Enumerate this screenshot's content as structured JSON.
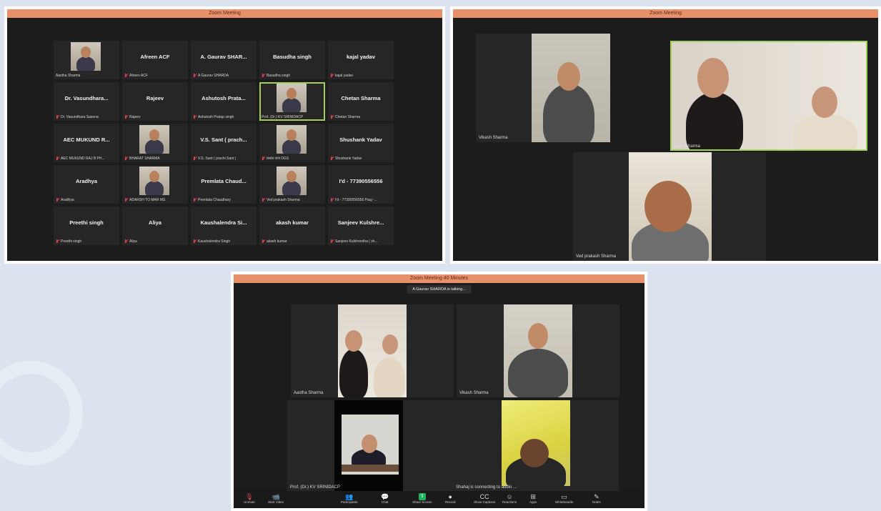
{
  "gallery": {
    "title": "Zoom Meeting",
    "tiles": [
      {
        "name": "",
        "label": "Aastha Sharma",
        "video": true,
        "muted": false
      },
      {
        "name": "Afreen ACF",
        "label": "Afreen ACF",
        "video": false,
        "muted": true
      },
      {
        "name": "A. Gaurav SHAR...",
        "label": "A Gaurav SHARDA",
        "video": false,
        "muted": true
      },
      {
        "name": "Basudha singh",
        "label": "Basudha singh",
        "video": false,
        "muted": true
      },
      {
        "name": "kajal yadav",
        "label": "kajal yadav",
        "video": false,
        "muted": true
      },
      {
        "name": "Dr. Vasundhara...",
        "label": "Dr. Vasundhara Saxena",
        "video": false,
        "muted": true
      },
      {
        "name": "Rajeev",
        "label": "Rajeev",
        "video": false,
        "muted": true
      },
      {
        "name": "Ashutosh Prata...",
        "label": "Ashutosh Pratap singh",
        "video": false,
        "muted": true
      },
      {
        "name": "",
        "label": "Prof. (Dr.) KV SRINIDACP",
        "video": true,
        "muted": false,
        "active": true
      },
      {
        "name": "Chetan Sharma",
        "label": "Chetan Sharma",
        "video": false,
        "muted": true
      },
      {
        "name": "AEC MUKUND R...",
        "label": "AEC MUKUND RAJ B PH...",
        "video": false,
        "muted": true
      },
      {
        "name": "",
        "label": "BHARAT SHARMA",
        "video": true,
        "muted": true
      },
      {
        "name": "V.S. Sant ( prach...",
        "label": "V.S. Sant ( prachi Sant )",
        "video": false,
        "muted": true
      },
      {
        "name": "",
        "label": "प्रशांत राज DGS",
        "video": true,
        "muted": true
      },
      {
        "name": "Shushank Yadav",
        "label": "Shushank Yadav",
        "video": false,
        "muted": true
      },
      {
        "name": "Aradhya",
        "label": "Aradhya",
        "video": false,
        "muted": true
      },
      {
        "name": "",
        "label": "ADARSH TO MAR MS",
        "video": true,
        "muted": true
      },
      {
        "name": "Premlata Chaud...",
        "label": "Premlata Chaudhary",
        "video": false,
        "muted": true
      },
      {
        "name": "",
        "label": "Ved prakash Sharma",
        "video": true,
        "muted": true
      },
      {
        "name": "I'd - 77390556556",
        "label": "I'd - 77390556556 Pauj -...",
        "video": false,
        "muted": true
      },
      {
        "name": "Preethi singh",
        "label": "Preethi singh",
        "video": false,
        "muted": true
      },
      {
        "name": "Aliya",
        "label": "Aliya",
        "video": false,
        "muted": true
      },
      {
        "name": "Kaushalendra Si...",
        "label": "Kaushalendra Singh",
        "video": false,
        "muted": true
      },
      {
        "name": "akash kumar",
        "label": "akash kumar",
        "video": false,
        "muted": true
      },
      {
        "name": "Sanjeev Kulshre...",
        "label": "Sanjeev Kulshrestha ( sh...",
        "video": false,
        "muted": true
      }
    ]
  },
  "speaker": {
    "title": "Zoom Meeting",
    "tiles": [
      {
        "label": "Vikash Sharma"
      },
      {
        "label": "aasthasharma"
      },
      {
        "label": "Ved prakash Sharma"
      }
    ]
  },
  "meeting": {
    "title": "Zoom Meeting 40 Minutes",
    "talking": "A Gaurav SHARDA is talking...",
    "tiles": [
      {
        "label": "Aastha Sharma"
      },
      {
        "label": "Vikash Sharma"
      },
      {
        "label": "Prof. (Dr.) KV SRINIDACP"
      },
      {
        "label": "Shahaj is connecting to audio ..."
      }
    ],
    "toolbar": [
      {
        "label": "Unmute",
        "icon": "mic-off-icon",
        "glyph": "🎙",
        "style": "red"
      },
      {
        "label": "Start Video",
        "icon": "video-off-icon",
        "glyph": "📹",
        "style": "red"
      },
      {
        "label": "Participants",
        "icon": "participants-icon",
        "glyph": "👥",
        "style": ""
      },
      {
        "label": "Chat",
        "icon": "chat-icon",
        "glyph": "💬",
        "style": ""
      },
      {
        "label": "Share Screen",
        "icon": "share-screen-icon",
        "glyph": "⇧",
        "style": "green"
      },
      {
        "label": "Record",
        "icon": "record-icon",
        "glyph": "●",
        "style": ""
      },
      {
        "label": "Show Captions",
        "icon": "captions-icon",
        "glyph": "CC",
        "style": ""
      },
      {
        "label": "Reactions",
        "icon": "reactions-icon",
        "glyph": "☺",
        "style": ""
      },
      {
        "label": "Apps",
        "icon": "apps-icon",
        "glyph": "⊞",
        "style": ""
      },
      {
        "label": "Whiteboards",
        "icon": "whiteboard-icon",
        "glyph": "▭",
        "style": ""
      },
      {
        "label": "Notes",
        "icon": "notes-icon",
        "glyph": "✎",
        "style": ""
      }
    ]
  }
}
